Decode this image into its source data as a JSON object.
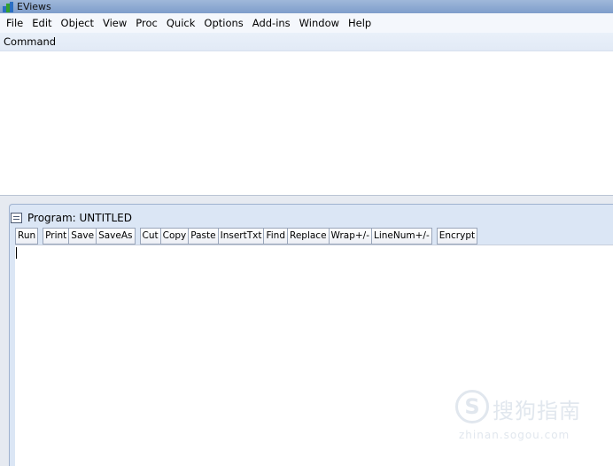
{
  "app": {
    "title": "EViews",
    "icon": "eviews-logo-icon"
  },
  "menu": [
    "File",
    "Edit",
    "Object",
    "View",
    "Proc",
    "Quick",
    "Options",
    "Add-ins",
    "Window",
    "Help"
  ],
  "command": {
    "label": "Command",
    "text": ""
  },
  "program_window": {
    "title": "Program: UNTITLED",
    "icon": "program-window-icon",
    "toolbar_groups": [
      [
        "Run"
      ],
      [
        "Print",
        "Save",
        "SaveAs"
      ],
      [
        "Cut",
        "Copy",
        "Paste",
        "InsertTxt",
        "Find",
        "Replace",
        "Wrap+/-",
        "LineNum+/-"
      ],
      [
        "Encrypt"
      ]
    ],
    "editor_text": ""
  },
  "watermark": {
    "logo_char": "S",
    "text": "搜狗指南",
    "url": "zhinan.sogou.com"
  },
  "colors": {
    "titlebar": "#8aa7d2",
    "menubar": "#f4f7fc",
    "command_bar": "#e6edf8",
    "window_frame": "#dbe6f5"
  }
}
